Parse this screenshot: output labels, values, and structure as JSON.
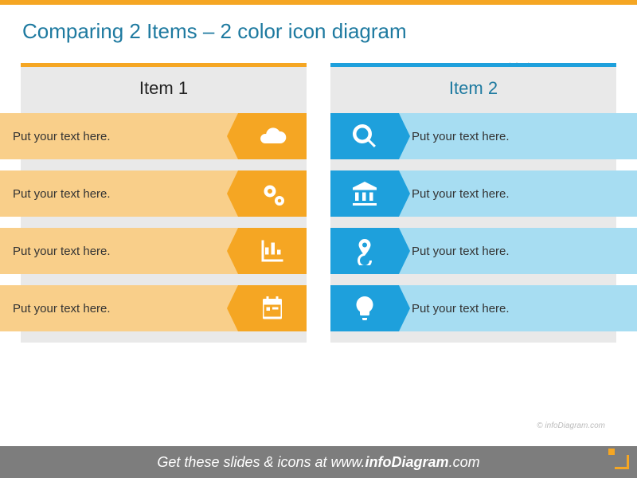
{
  "title": "Comparing 2 Items – 2 color icon diagram",
  "columns": {
    "left": {
      "header": "Item 1",
      "rows": [
        {
          "text": "Put your text here.",
          "icon": "cloud-icon"
        },
        {
          "text": "Put your text here.",
          "icon": "gears-icon"
        },
        {
          "text": "Put your text here.",
          "icon": "bar-chart-icon"
        },
        {
          "text": "Put your text here.",
          "icon": "calendar-icon"
        }
      ]
    },
    "right": {
      "header": "Item 2",
      "rows": [
        {
          "text": "Put your text here.",
          "icon": "magnifier-icon"
        },
        {
          "text": "Put your text here.",
          "icon": "bank-icon"
        },
        {
          "text": "Put your text here.",
          "icon": "target-pin-icon"
        },
        {
          "text": "Put your text here.",
          "icon": "lightbulb-icon"
        }
      ]
    }
  },
  "watermark": "© infoDiagram.com",
  "footer": {
    "prefix": "Get these slides & icons at ",
    "brand_pre": "www.",
    "brand_bold": "infoDiagram",
    "brand_post": ".com"
  },
  "colors": {
    "orange": "#f5a623",
    "blue": "#1ea0dc"
  }
}
